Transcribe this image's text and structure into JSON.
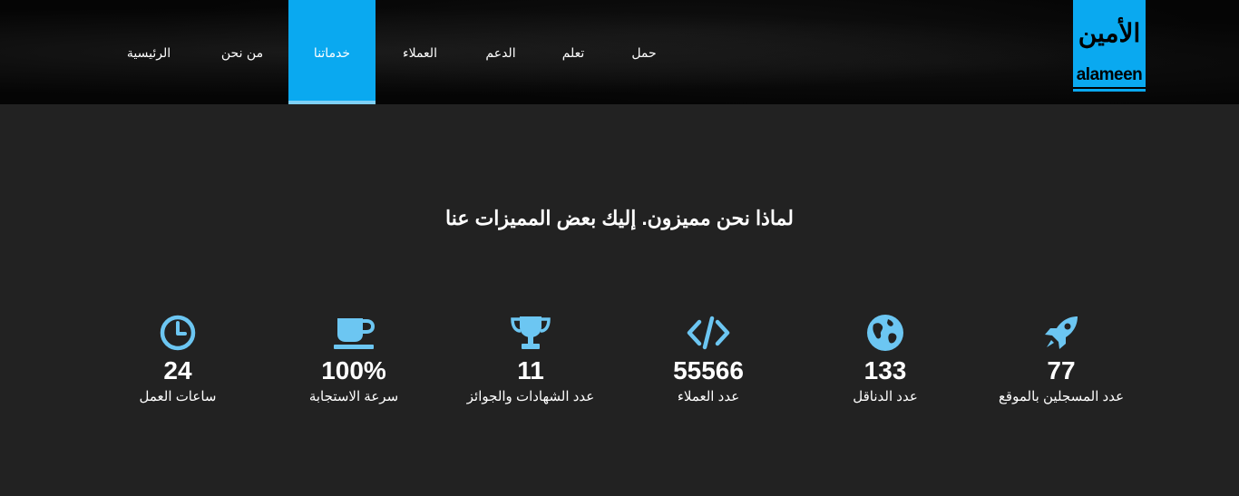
{
  "nav": {
    "items": [
      {
        "label": "حمل"
      },
      {
        "label": "تعلم"
      },
      {
        "label": "الدعم"
      },
      {
        "label": "العملاء"
      },
      {
        "label": "خدماتنا",
        "active": true
      },
      {
        "label": "من نحن"
      },
      {
        "label": "الرئيسية"
      }
    ]
  },
  "logo": {
    "arabic": "الأمين",
    "latin": "alameen"
  },
  "section": {
    "heading": "لماذا نحن مميزون. إليك بعض المميزات عنا"
  },
  "stats": [
    {
      "icon": "rocket-icon",
      "value": "77",
      "label": "عدد المسجلين بالموقع"
    },
    {
      "icon": "globe-icon",
      "value": "133",
      "label": "عدد الدناقل"
    },
    {
      "icon": "code-icon",
      "value": "55566",
      "label": "عدد العملاء"
    },
    {
      "icon": "trophy-icon",
      "value": "11",
      "label": "عدد الشهادات والجوائز"
    },
    {
      "icon": "coffee-cup-icon",
      "value": "100%",
      "label": "سرعة الاستجابة"
    },
    {
      "icon": "clock-icon",
      "value": "24",
      "label": "ساعات العمل"
    }
  ],
  "colors": {
    "accent": "#0aa9f0",
    "icon": "#6cc6f2",
    "background": "#222222",
    "header": "#050505"
  }
}
